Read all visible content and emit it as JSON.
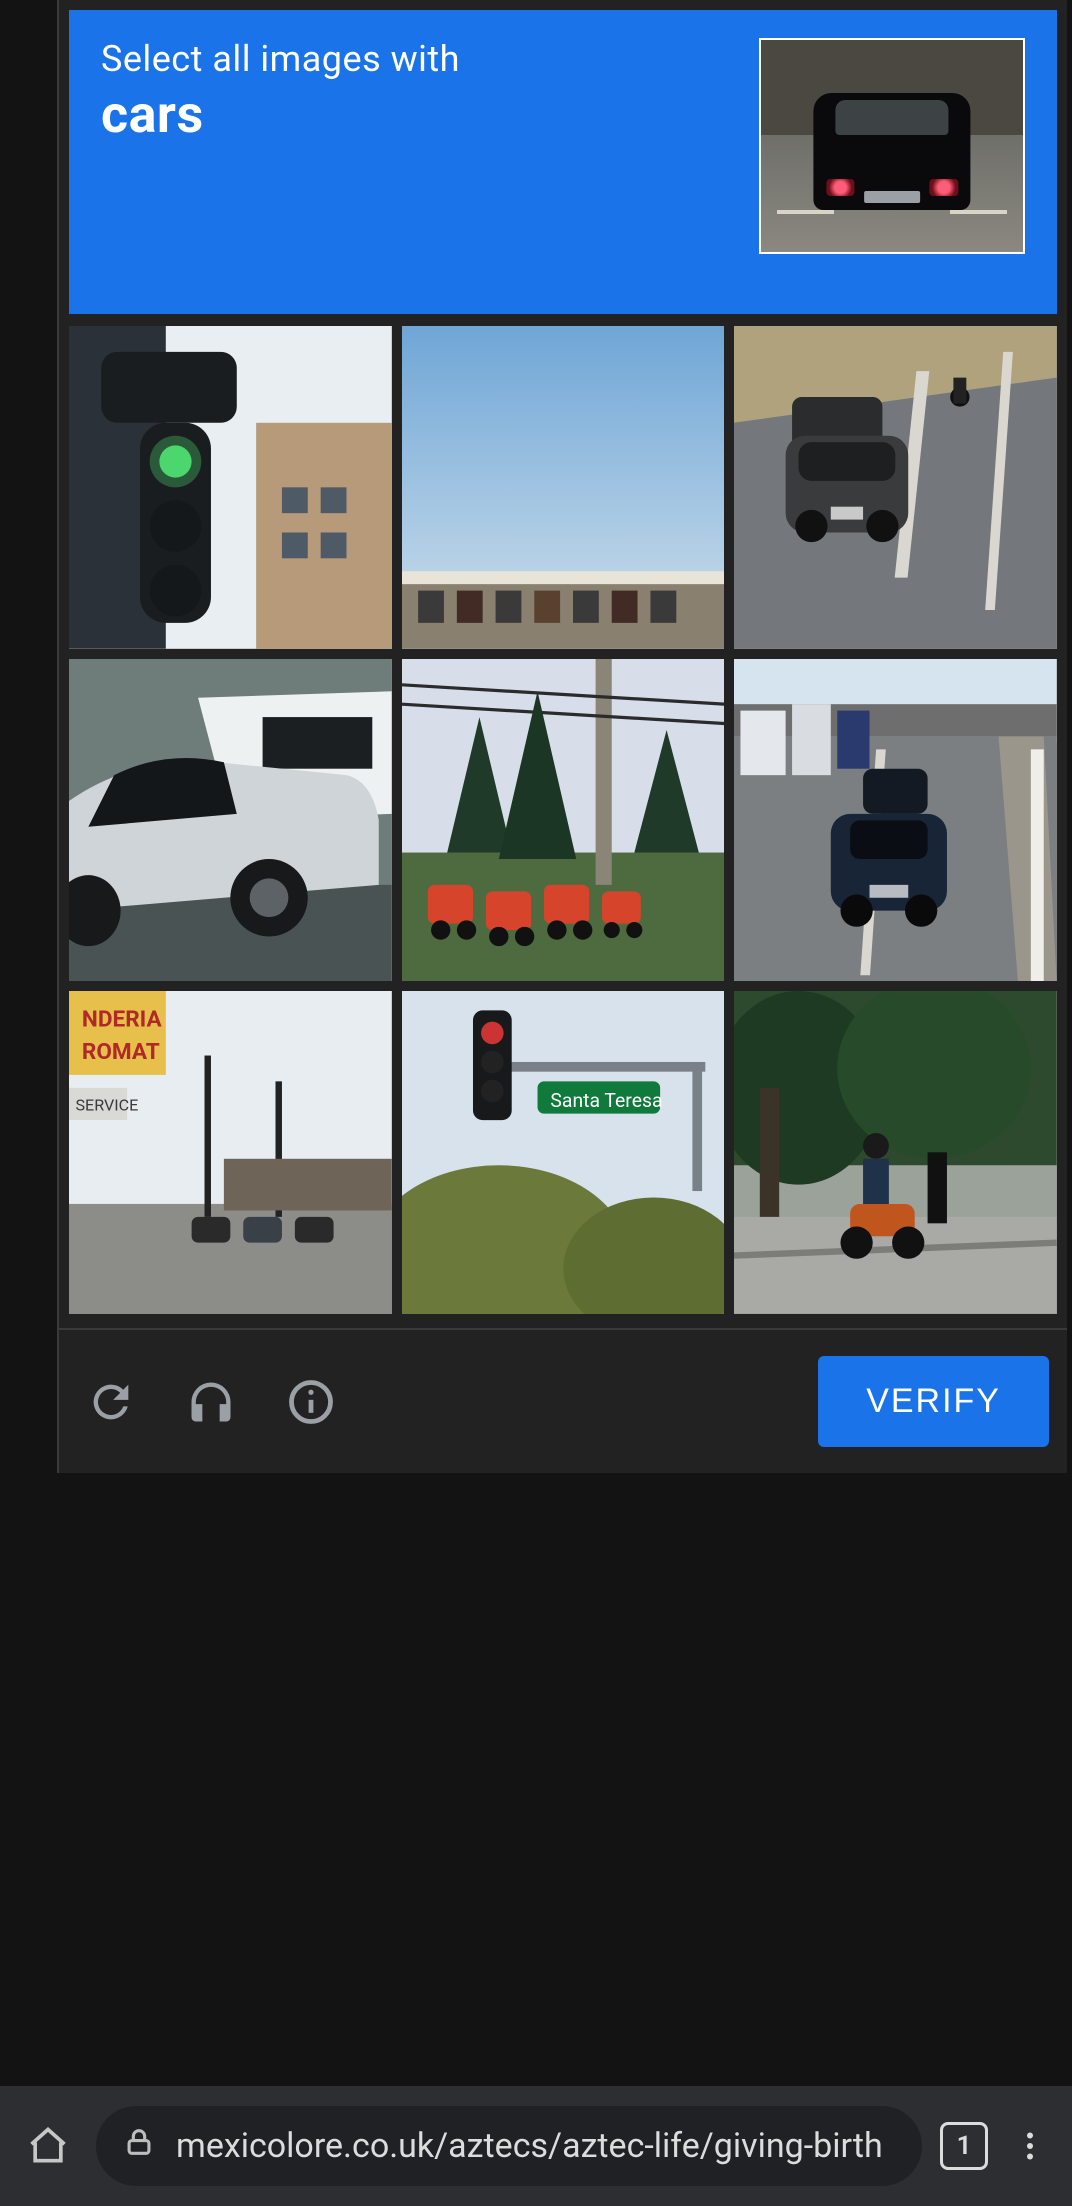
{
  "captcha": {
    "prompt_line1": "Select all images with",
    "prompt_target": "cars",
    "verify_label": "VERIFY",
    "tiles": [
      {
        "id": 0,
        "depicts": "traffic light against building",
        "has_target": false
      },
      {
        "id": 1,
        "depicts": "sky over distant lot",
        "has_target": false
      },
      {
        "id": 2,
        "depicts": "car and motorcycle on highway",
        "has_target": true
      },
      {
        "id": 3,
        "depicts": "silver sedan in showroom",
        "has_target": true
      },
      {
        "id": 4,
        "depicts": "red tractors among pine trees",
        "has_target": false
      },
      {
        "id": 5,
        "depicts": "vehicles on multi-lane highway",
        "has_target": true
      },
      {
        "id": 6,
        "depicts": "street view with laundromat sign",
        "has_target": true
      },
      {
        "id": 7,
        "depicts": "traffic signal with street sign Santa Teresa",
        "has_target": false
      },
      {
        "id": 8,
        "depicts": "person with motorcycle on tree-lined sidewalk",
        "has_target": false
      }
    ]
  },
  "browser": {
    "url": "mexicolore.co.uk/aztecs/aztec-life/giving-birth",
    "tab_count": "1"
  }
}
